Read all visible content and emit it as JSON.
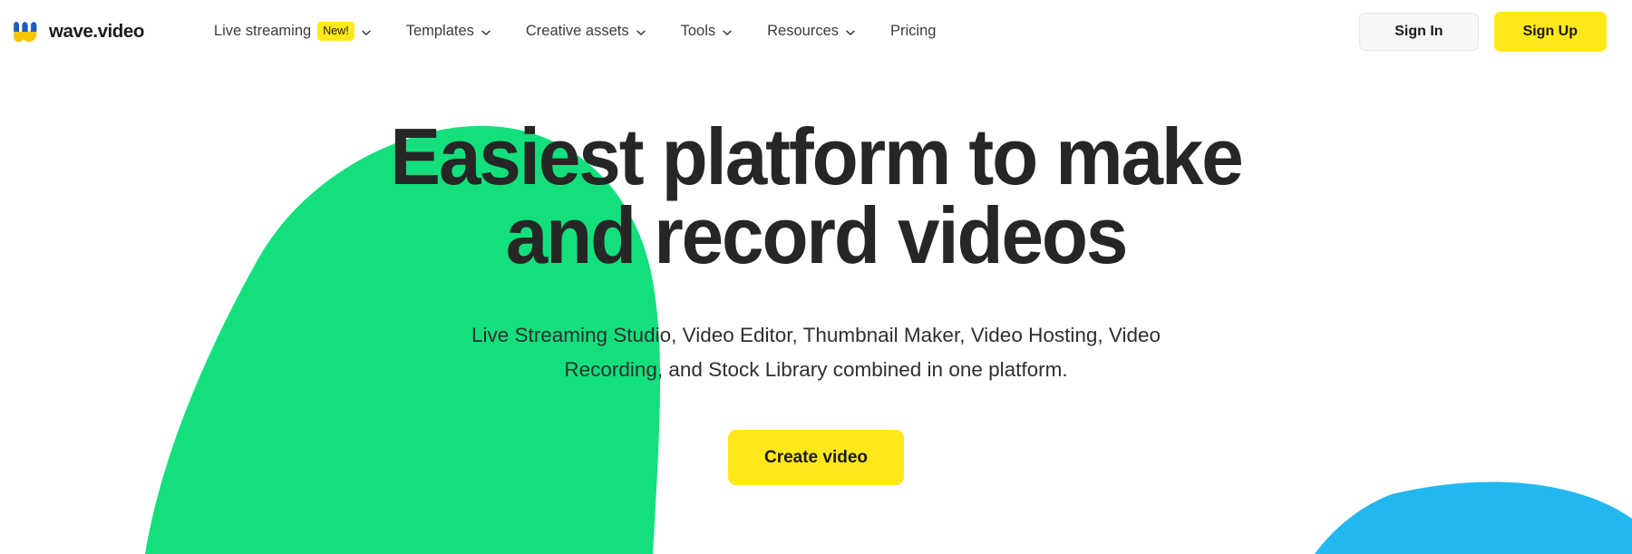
{
  "brand": {
    "name": "wave.video",
    "logo_icon": "wave-w-logo-icon",
    "logo_colors": {
      "top": "#1d5bbf",
      "bottom": "#f5c500"
    }
  },
  "nav": {
    "items": [
      {
        "label": "Live streaming",
        "badge": "New!",
        "has_chevron": true
      },
      {
        "label": "Templates",
        "badge": null,
        "has_chevron": true
      },
      {
        "label": "Creative assets",
        "badge": null,
        "has_chevron": true
      },
      {
        "label": "Tools",
        "badge": null,
        "has_chevron": true
      },
      {
        "label": "Resources",
        "badge": null,
        "has_chevron": true
      },
      {
        "label": "Pricing",
        "badge": null,
        "has_chevron": false
      }
    ]
  },
  "header_actions": {
    "sign_in_label": "Sign In",
    "sign_up_label": "Sign Up"
  },
  "hero": {
    "title_line1": "Easiest platform to make",
    "title_line2": "and record videos",
    "subtitle": "Live Streaming Studio, Video Editor, Thumbnail Maker, Video Hosting, Video Recording, and Stock Library combined in one platform.",
    "cta_label": "Create video"
  },
  "decor": {
    "green_blob_color": "#13e07c",
    "blue_blob_color": "#23b7f0"
  },
  "colors": {
    "accent_yellow": "#ffe81a",
    "text_dark": "#262626",
    "text_body": "#2f2f2f",
    "button_light": "#f6f7f9",
    "border_light": "#e2e5ea"
  }
}
